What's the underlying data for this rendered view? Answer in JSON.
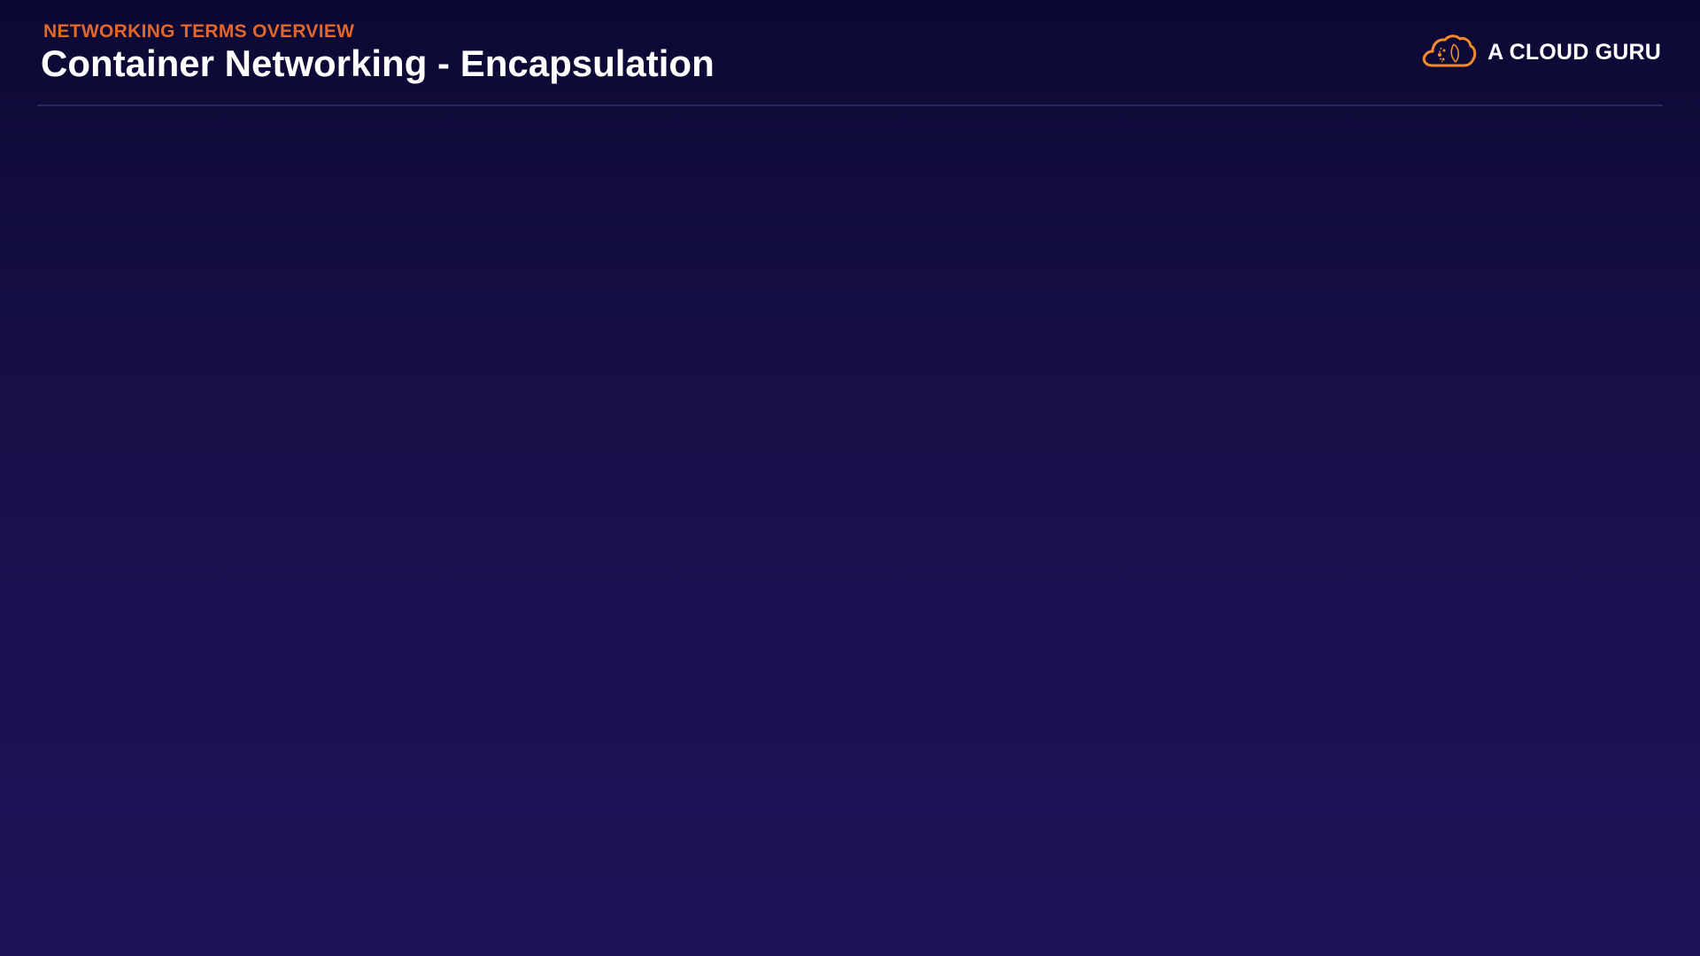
{
  "header": {
    "eyebrow": "NETWORKING TERMS OVERVIEW",
    "title": "Container Networking - Encapsulation"
  },
  "brand": {
    "name": "A CLOUD GURU",
    "logo_icon": "cloud-logo-icon",
    "logo_color": "#f08a2c"
  },
  "colors": {
    "eyebrow": "#e0662a",
    "title": "#ffffff",
    "background_top": "#0c0834",
    "background_bottom": "#1c1356",
    "divider": "#2b2660"
  }
}
